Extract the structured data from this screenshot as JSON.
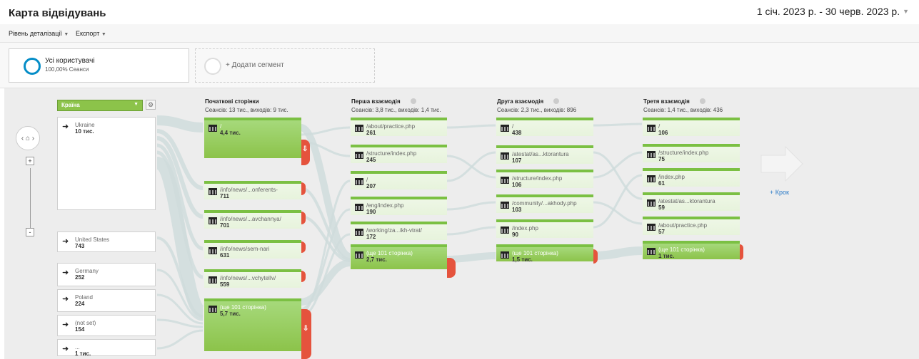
{
  "header": {
    "title": "Карта відвідувань",
    "date_range": "1 січ. 2023 р. - 30 черв. 2023 р."
  },
  "toolbar": {
    "detail_level": "Рівень деталізації",
    "export": "Експорт"
  },
  "segments": {
    "active_name": "Усі користувачі",
    "active_sub": "100,00% Сеанси",
    "add_label": "+ Додати сегмент"
  },
  "dimension": {
    "selected": "Країна"
  },
  "countries": [
    {
      "label": "Ukraine",
      "value": "10 тис."
    },
    {
      "label": "United States",
      "value": "743"
    },
    {
      "label": "Germany",
      "value": "252"
    },
    {
      "label": "Poland",
      "value": "224"
    },
    {
      "label": "(not set)",
      "value": "154"
    },
    {
      "label": "...",
      "value": "1 тис."
    }
  ],
  "columns": [
    {
      "title": "Початкові сторінки",
      "stats": "Сеансів: 13 тис., виходів: 9 тис.",
      "nodes": [
        {
          "label": "/",
          "value": "4,4 тис."
        },
        {
          "label": "/info/news/...onferents-",
          "value": "711"
        },
        {
          "label": "/info/news/...avchannya/",
          "value": "701"
        },
        {
          "label": "/info/news/sem-nari",
          "value": "631"
        },
        {
          "label": "/info/news/...vchytelIv/",
          "value": "559"
        },
        {
          "label": "(ще 101 сторінка)",
          "value": "5,7 тис."
        }
      ]
    },
    {
      "title": "Перша взаємодія",
      "stats": "Сеансів: 3,8 тис., виходів: 1,4 тис.",
      "nodes": [
        {
          "label": "/about/practice.php",
          "value": "261"
        },
        {
          "label": "/structure/index.php",
          "value": "245"
        },
        {
          "label": "/",
          "value": "207"
        },
        {
          "label": "/eng/index.php",
          "value": "190"
        },
        {
          "label": "/working/za...ikh-vtrat/",
          "value": "172"
        },
        {
          "label": "(ще 101 сторінка)",
          "value": "2,7 тис."
        }
      ]
    },
    {
      "title": "Друга взаємодія",
      "stats": "Сеансів: 2,3 тис., виходів: 896",
      "nodes": [
        {
          "label": "/",
          "value": "438"
        },
        {
          "label": "/atestat/as...ktorantura",
          "value": "107"
        },
        {
          "label": "/structure/index.php",
          "value": "106"
        },
        {
          "label": "/community/...akhody.php",
          "value": "103"
        },
        {
          "label": "/index.php",
          "value": "90"
        },
        {
          "label": "(ще 101 сторінка)",
          "value": "1,5 тис."
        }
      ]
    },
    {
      "title": "Третя взаємодія",
      "stats": "Сеансів: 1,4 тис., виходів: 436",
      "nodes": [
        {
          "label": "/",
          "value": "106"
        },
        {
          "label": "/structure/index.php",
          "value": "75"
        },
        {
          "label": "/index.php",
          "value": "61"
        },
        {
          "label": "/atestat/as...ktorantura",
          "value": "59"
        },
        {
          "label": "/about/practice.php",
          "value": "57"
        },
        {
          "label": "(ще 101 сторінка)",
          "value": "1 тис."
        }
      ]
    }
  ],
  "add_step": "+ Крок",
  "colors": {
    "node_green": "#8cc34a",
    "exit_red": "#e5533d",
    "flow": "#cfdcdc",
    "accent_blue": "#058dc7"
  }
}
